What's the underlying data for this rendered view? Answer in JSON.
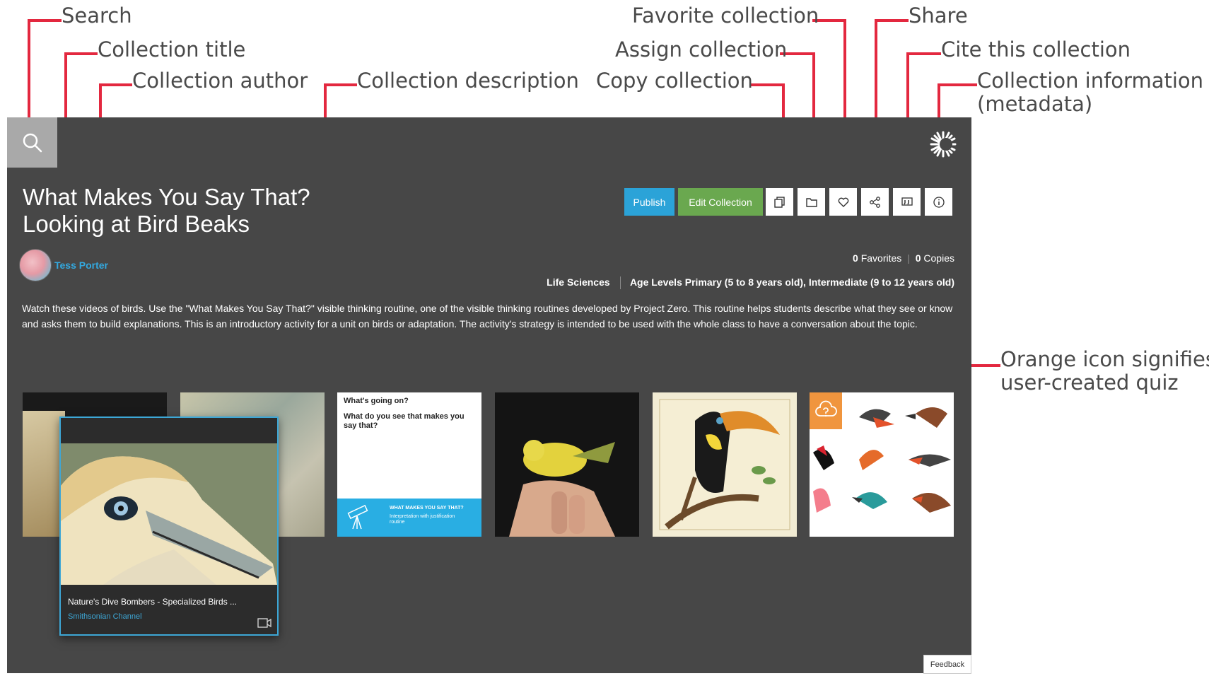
{
  "annotations": {
    "search": "Search",
    "collection_title": "Collection title",
    "collection_author": "Collection author",
    "collection_description": "Collection description",
    "favorite_collection": "Favorite collection",
    "share": "Share",
    "assign_collection": "Assign collection",
    "cite_collection": "Cite this collection",
    "copy_collection": "Copy collection",
    "collection_information_line1": "Collection information",
    "collection_information_line2": "(metadata)",
    "orange_icon_line1": "Orange icon signifies",
    "orange_icon_line2": "user-created quiz"
  },
  "collection": {
    "title_line1": "What Makes You Say That?",
    "title_line2": "Looking at Bird Beaks",
    "author": "Tess Porter",
    "description": "Watch these videos of birds. Use the \"What Makes You Say That?\" visible thinking routine, one of the visible thinking routines developed by Project Zero. This routine helps students describe what they see or know and asks them to build explanations. This is an introductory activity for a unit on birds or adaptation. The activity's strategy is intended to be used with the whole class to have a conversation about the topic.",
    "favorites_count": "0",
    "favorites_label": "Favorites",
    "copies_count": "0",
    "copies_label": "Copies",
    "subject": "Life Sciences",
    "age_levels": "Age Levels Primary (5 to 8 years old), Intermediate (9 to 12 years old)"
  },
  "toolbar": {
    "publish_label": "Publish",
    "edit_label": "Edit Collection",
    "icons": [
      "copy-icon",
      "folder-icon",
      "heart-icon",
      "share-icon",
      "quote-icon",
      "info-icon"
    ]
  },
  "resources": {
    "hover_card": {
      "title": "Nature's Dive Bombers - Specialized Birds ...",
      "source": "Smithsonian Channel"
    },
    "routine_card": {
      "q1": "What's going on?",
      "q2": "What do you see that makes you say that?",
      "band_title": "WHAT MAKES YOU SAY THAT?",
      "band_sub": "Interpretation with justification routine"
    }
  },
  "feedback_label": "Feedback",
  "colors": {
    "panel": "#474747",
    "accent_red": "#e3283f",
    "publish": "#2ba3d8",
    "edit": "#6aa84f",
    "quiz_orange": "#f0953e",
    "author_link": "#33a9e0"
  }
}
